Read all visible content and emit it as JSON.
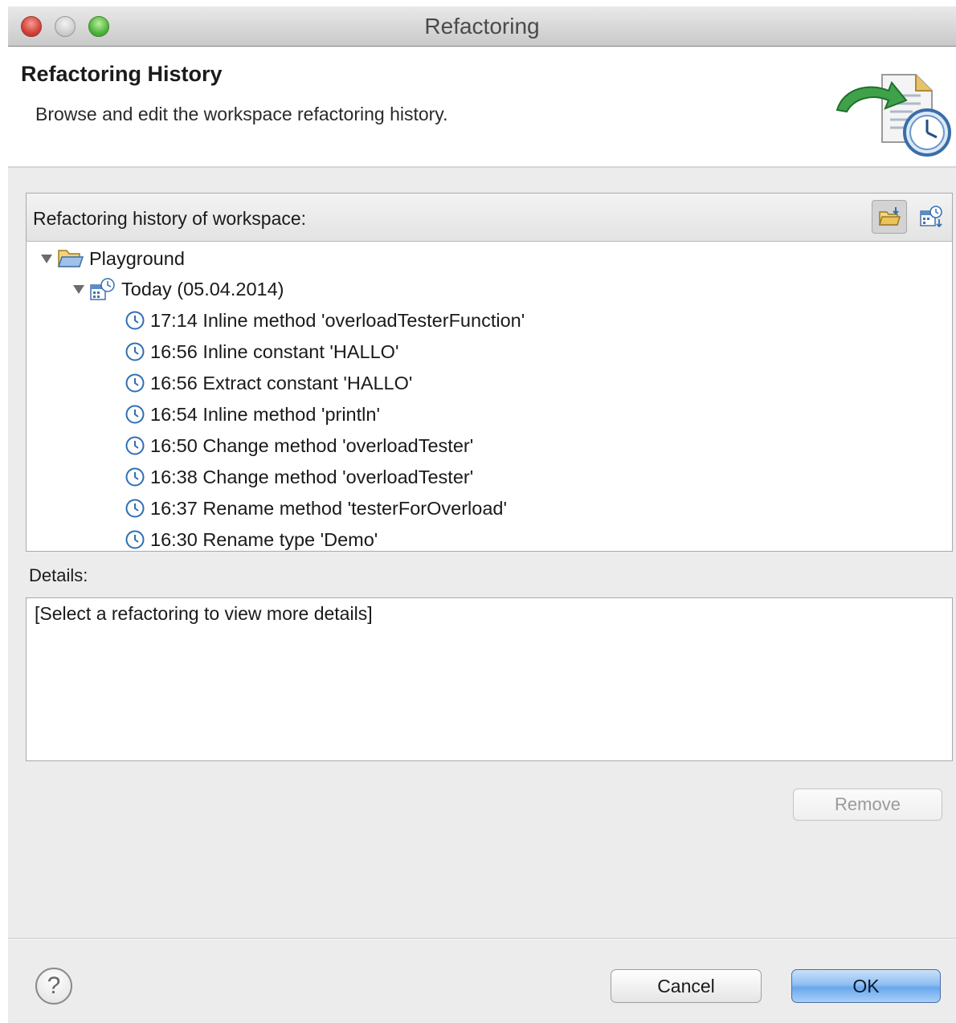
{
  "window": {
    "title": "Refactoring"
  },
  "header": {
    "title": "Refactoring History",
    "description": "Browse and edit the workspace refactoring history."
  },
  "history": {
    "label": "Refactoring history of workspace:",
    "tree": {
      "project": "Playground",
      "date_group": "Today (05.04.2014)",
      "entries": [
        "17:14 Inline method 'overloadTesterFunction'",
        "16:56 Inline constant 'HALLO'",
        "16:56 Extract constant 'HALLO'",
        "16:54 Inline method 'println'",
        "16:50 Change method 'overloadTester'",
        "16:38 Change method 'overloadTester'",
        "16:37 Rename method 'testerForOverload'",
        "16:30 Rename type 'Demo'"
      ]
    }
  },
  "details": {
    "label": "Details:",
    "placeholder": "[Select a refactoring to view more details]"
  },
  "buttons": {
    "remove": "Remove",
    "help": "?",
    "cancel": "Cancel",
    "ok": "OK"
  },
  "icons": {
    "entry": "clock-icon",
    "project": "open-folder-icon",
    "date_group": "calendar-clock-icon",
    "toolbar_left": "folder-sort-icon",
    "toolbar_right": "calendar-sort-icon",
    "wizard": "refactoring-history-wizard-icon"
  },
  "colors": {
    "ok_button": "#8fbff2",
    "clock_icon": "#2f6fb3"
  }
}
